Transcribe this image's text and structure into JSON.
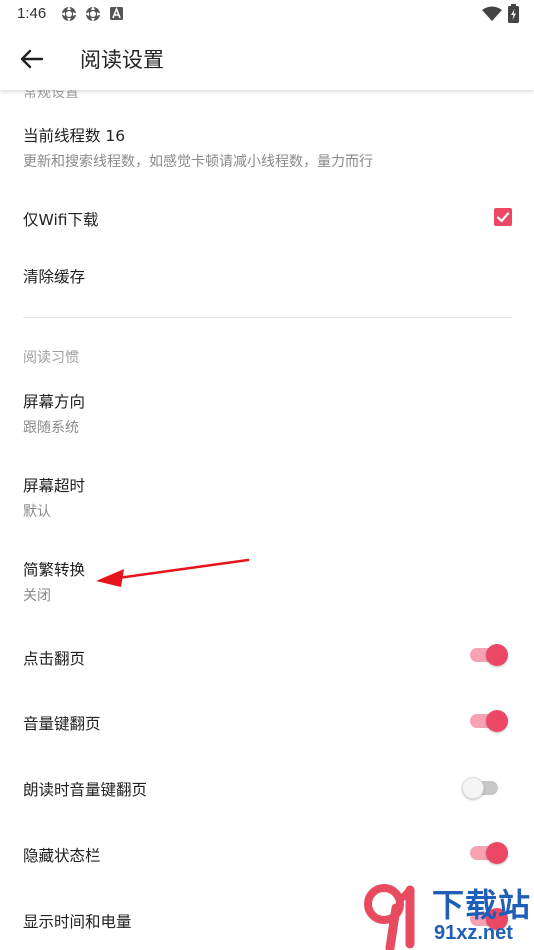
{
  "status_bar": {
    "time": "1:46",
    "left_icons": [
      "settings-gear-icon",
      "settings-gear-icon",
      "a-square-icon"
    ],
    "right_icons": [
      "wifi-icon",
      "battery-charging-icon"
    ]
  },
  "app_bar": {
    "title": "阅读设置",
    "back_icon": "arrow-left-icon"
  },
  "sections": {
    "general": {
      "category": "常规设置",
      "thread_count": {
        "title": "当前线程数 16",
        "summary": "更新和搜索线程数，如感觉卡顿请减小线程数，量力而行"
      },
      "wifi_only": {
        "title": "仅Wifi下载",
        "checked": true
      },
      "clear_cache": {
        "title": "清除缓存"
      }
    },
    "reading_habits": {
      "category": "阅读习惯",
      "screen_orientation": {
        "title": "屏幕方向",
        "value": "跟随系统"
      },
      "screen_timeout": {
        "title": "屏幕超时",
        "value": "默认"
      },
      "chinese_conversion": {
        "title": "简繁转换",
        "value": "关闭"
      },
      "tap_to_turn": {
        "title": "点击翻页",
        "on": true
      },
      "volume_key_turn": {
        "title": "音量键翻页",
        "on": true
      },
      "tts_volume_key_turn": {
        "title": "朗读时音量键翻页",
        "on": false
      },
      "hide_status_bar": {
        "title": "隐藏状态栏",
        "on": true
      },
      "show_time_battery": {
        "title": "显示时间和电量",
        "on": true
      }
    }
  },
  "watermark": {
    "text_top": "下载站",
    "text_bottom": "91xz.net"
  },
  "colors": {
    "accent": "#ec4866",
    "accent_light": "#f5a3b3",
    "annotation_arrow": "#e8141c",
    "watermark": "#1f5fb8"
  }
}
